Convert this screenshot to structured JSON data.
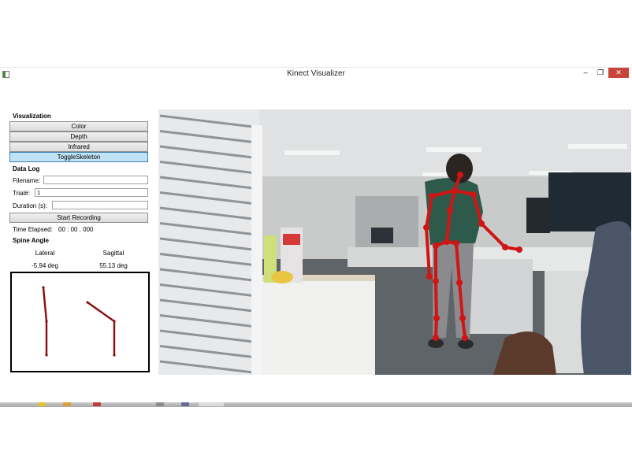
{
  "window": {
    "title": "Kinect Visualizer",
    "minimize": "–",
    "maximize": "❐",
    "close": "✕"
  },
  "visualization": {
    "heading": "Visualization",
    "buttons": [
      "Color",
      "Depth",
      "Infrared",
      "ToggleSkeleton"
    ],
    "active_button": "ToggleSkeleton"
  },
  "datalog": {
    "heading": "Data Log",
    "filename_label": "Filename:",
    "filename_value": "",
    "trial_label": "Trial#:",
    "trial_value": "1",
    "duration_label": "Duration (s):",
    "duration_value": "",
    "record_button": "Start Recording",
    "elapsed_label": "Time Elapsed:",
    "elapsed_value": "00 : 00 . 000"
  },
  "spine": {
    "heading": "Spine Angle",
    "lateral_label": "Lateral",
    "sagittal_label": "Sagittal",
    "lateral_value": "-5.94 deg",
    "sagittal_value": "55.13 deg"
  },
  "colors": {
    "skeleton": "#d01515",
    "plot_line": "#8b0d0d",
    "active_button": "#bfe3f5",
    "close_button": "#c7453a"
  }
}
